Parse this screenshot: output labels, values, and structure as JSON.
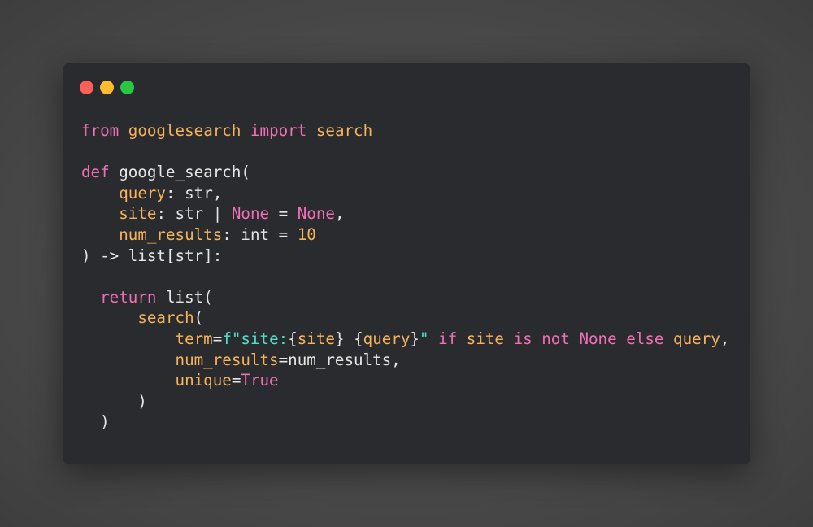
{
  "window": {
    "controls": [
      {
        "name": "close",
        "color": "#fe5f57"
      },
      {
        "name": "minimize",
        "color": "#febc2e"
      },
      {
        "name": "maximize",
        "color": "#28c840"
      }
    ]
  },
  "colors": {
    "background": "#4a4a4a",
    "window": "#2a2b2e",
    "keyword": "#f06fb5",
    "identifier": "#f6b35b",
    "plain": "#e6e6e6",
    "string": "#4fe0c8"
  },
  "code": {
    "lines": [
      [
        {
          "t": "from",
          "c": "keyword"
        },
        {
          "t": " ",
          "c": "plain"
        },
        {
          "t": "googlesearch",
          "c": "orange"
        },
        {
          "t": " ",
          "c": "plain"
        },
        {
          "t": "import",
          "c": "keyword"
        },
        {
          "t": " ",
          "c": "plain"
        },
        {
          "t": "search",
          "c": "orange"
        }
      ],
      [],
      [
        {
          "t": "def",
          "c": "keyword"
        },
        {
          "t": " google_search(",
          "c": "plain"
        }
      ],
      [
        {
          "t": "    ",
          "c": "plain"
        },
        {
          "t": "query",
          "c": "orange"
        },
        {
          "t": ": str,",
          "c": "plain"
        }
      ],
      [
        {
          "t": "    ",
          "c": "plain"
        },
        {
          "t": "site",
          "c": "orange"
        },
        {
          "t": ": str | ",
          "c": "plain"
        },
        {
          "t": "None",
          "c": "pink"
        },
        {
          "t": " = ",
          "c": "plain"
        },
        {
          "t": "None",
          "c": "pink"
        },
        {
          "t": ",",
          "c": "plain"
        }
      ],
      [
        {
          "t": "    ",
          "c": "plain"
        },
        {
          "t": "num_results",
          "c": "orange"
        },
        {
          "t": ": int = ",
          "c": "plain"
        },
        {
          "t": "10",
          "c": "orange"
        }
      ],
      [
        {
          "t": ") -> list[str]:",
          "c": "plain"
        }
      ],
      [],
      [
        {
          "t": "  ",
          "c": "plain"
        },
        {
          "t": "return",
          "c": "keyword"
        },
        {
          "t": " list(",
          "c": "plain"
        }
      ],
      [
        {
          "t": "      ",
          "c": "plain"
        },
        {
          "t": "search",
          "c": "orange"
        },
        {
          "t": "(",
          "c": "plain"
        }
      ],
      [
        {
          "t": "          ",
          "c": "plain"
        },
        {
          "t": "term",
          "c": "orange"
        },
        {
          "t": "=",
          "c": "plain"
        },
        {
          "t": "f\"site:",
          "c": "string"
        },
        {
          "t": "{",
          "c": "plain"
        },
        {
          "t": "site",
          "c": "orange"
        },
        {
          "t": "}",
          "c": "plain"
        },
        {
          "t": " ",
          "c": "string"
        },
        {
          "t": "{",
          "c": "plain"
        },
        {
          "t": "query",
          "c": "orange"
        },
        {
          "t": "}",
          "c": "plain"
        },
        {
          "t": "\"",
          "c": "string"
        },
        {
          "t": " ",
          "c": "plain"
        },
        {
          "t": "if",
          "c": "keyword"
        },
        {
          "t": " ",
          "c": "plain"
        },
        {
          "t": "site",
          "c": "orange"
        },
        {
          "t": " ",
          "c": "plain"
        },
        {
          "t": "is",
          "c": "keyword"
        },
        {
          "t": " ",
          "c": "plain"
        },
        {
          "t": "not",
          "c": "keyword"
        },
        {
          "t": " ",
          "c": "plain"
        },
        {
          "t": "None",
          "c": "pink"
        },
        {
          "t": " ",
          "c": "plain"
        },
        {
          "t": "else",
          "c": "keyword"
        },
        {
          "t": " ",
          "c": "plain"
        },
        {
          "t": "query",
          "c": "orange"
        },
        {
          "t": ",",
          "c": "plain"
        }
      ],
      [
        {
          "t": "          ",
          "c": "plain"
        },
        {
          "t": "num_results",
          "c": "orange"
        },
        {
          "t": "=num_results,",
          "c": "plain"
        }
      ],
      [
        {
          "t": "          ",
          "c": "plain"
        },
        {
          "t": "unique",
          "c": "orange"
        },
        {
          "t": "=",
          "c": "plain"
        },
        {
          "t": "True",
          "c": "pink"
        }
      ],
      [
        {
          "t": "      )",
          "c": "plain"
        }
      ],
      [
        {
          "t": "  )",
          "c": "plain"
        }
      ]
    ]
  }
}
